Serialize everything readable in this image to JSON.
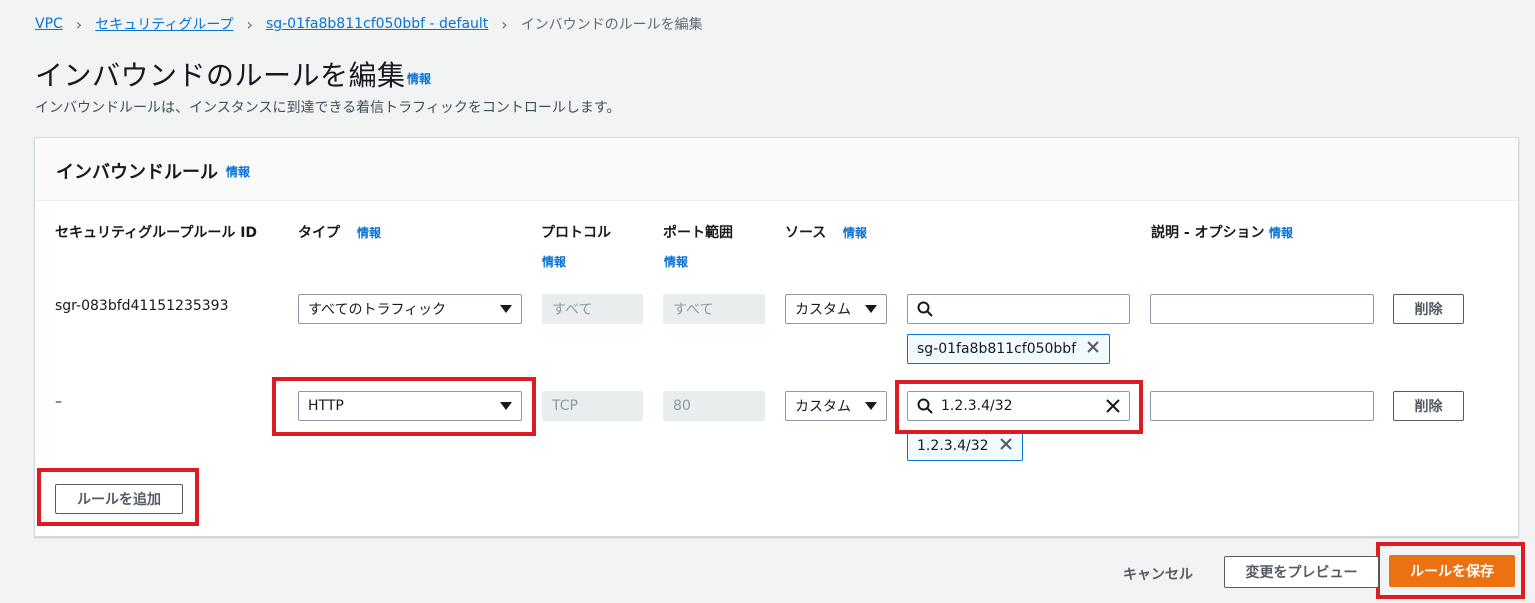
{
  "breadcrumb": {
    "items": [
      "VPC",
      "セキュリティグループ",
      "sg-01fa8b811cf050bbf - default"
    ],
    "current": "インバウンドのルールを編集"
  },
  "page": {
    "title": "インバウンドのルールを編集",
    "info": "情報",
    "description": "インバウンドルールは、インスタンスに到達できる着信トラフィックをコントロールします。"
  },
  "panel": {
    "title": "インバウンドルール",
    "info": "情報"
  },
  "columns": {
    "rule_id": "セキュリティグループルール ID",
    "type": "タイプ",
    "type_info": "情報",
    "protocol": "プロトコル",
    "protocol_info": "情報",
    "port_range": "ポート範囲",
    "port_info": "情報",
    "source": "ソース",
    "source_info": "情報",
    "description": "説明 - オプション",
    "description_info": "情報"
  },
  "rows": [
    {
      "rule_id": "sgr-083bfd41151235393",
      "type": "すべてのトラフィック",
      "protocol": "すべて",
      "port": "すべて",
      "source_type": "カスタム",
      "source_search": "",
      "token": "sg-01fa8b811cf050bbf",
      "description": "",
      "delete_label": "削除"
    },
    {
      "rule_id": "–",
      "type": "HTTP",
      "protocol": "TCP",
      "port": "80",
      "source_type": "カスタム",
      "source_search": "1.2.3.4/32",
      "token": "1.2.3.4/32",
      "description": "",
      "delete_label": "削除"
    }
  ],
  "add_rule_label": "ルールを追加",
  "footer": {
    "cancel": "キャンセル",
    "preview": "変更をプレビュー",
    "save": "ルールを保存"
  },
  "colors": {
    "link": "#0972d3",
    "primary": "#ec7211",
    "highlight": "#dd1b22"
  }
}
